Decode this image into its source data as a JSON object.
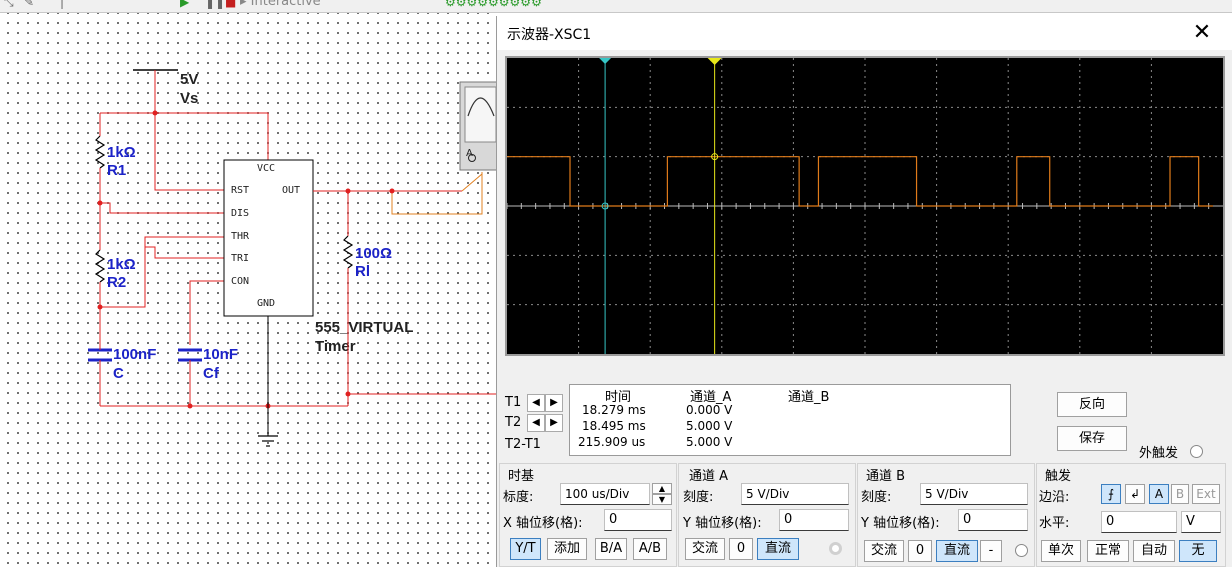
{
  "toolbar": {
    "sim_status": "▸ Interactive"
  },
  "schematic": {
    "vs_voltage": "5V",
    "vs_name": "Vs",
    "r1_value": "1kΩ",
    "r1_name": "R1",
    "r2_value": "1kΩ",
    "r2_name": "R2",
    "rl_value": "100Ω",
    "rl_name": "Rl",
    "c_value": "100nF",
    "c_name": "C",
    "cf_value": "10nF",
    "cf_name": "Cf",
    "timer_name": "555_VIRTUAL",
    "timer_type": "Timer",
    "pins": {
      "vcc": "VCC",
      "rst": "RST",
      "out": "OUT",
      "dis": "DIS",
      "thr": "THR",
      "tri": "TRI",
      "con": "CON",
      "gnd": "GND"
    },
    "probe_channel": "A"
  },
  "scope": {
    "title": "示波器-XSC1",
    "close_glyph": "✕",
    "cursor_t1": "T1",
    "cursor_t2": "T2",
    "cursor_diff": "T2-T1",
    "readout_headers": [
      "时间",
      "通道_A",
      "通道_B"
    ],
    "readout_rows": [
      {
        "time": "18.279 ms",
        "a": "0.000 V",
        "b": ""
      },
      {
        "time": "18.495 ms",
        "a": "5.000 V",
        "b": ""
      },
      {
        "time": "215.909 us",
        "a": "5.000 V",
        "b": ""
      }
    ],
    "reverse_button": "反向",
    "save_button": "保存",
    "ext_trigger_label": "外触发",
    "timebase": {
      "title": "时基",
      "scale_label": "标度:",
      "scale_value": "100 us/Div",
      "xpos_label": "X 轴位移(格):",
      "xpos_value": "0",
      "mode_buttons": [
        "Y/T",
        "添加",
        "B/A",
        "A/B"
      ],
      "selected_mode": "Y/T"
    },
    "channel_a": {
      "title": "通道 A",
      "scale_label": "刻度:",
      "scale_value": "5  V/Div",
      "ypos_label": "Y 轴位移(格):",
      "ypos_value": "0",
      "coupling_buttons": [
        "交流",
        "0",
        "直流"
      ],
      "selected_coupling": "直流"
    },
    "channel_b": {
      "title": "通道 B",
      "scale_label": "刻度:",
      "scale_value": "5  V/Div",
      "ypos_label": "Y 轴位移(格):",
      "ypos_value": "0",
      "coupling_buttons": [
        "交流",
        "0",
        "直流",
        "-"
      ],
      "selected_coupling": "直流"
    },
    "trigger": {
      "title": "触发",
      "edge_label": "边沿:",
      "source_buttons": [
        "A",
        "B",
        "Ext"
      ],
      "selected_source": "A",
      "level_label": "水平:",
      "level_value": "0",
      "level_unit": "V",
      "mode_buttons": [
        "单次",
        "正常",
        "自动",
        "无"
      ],
      "selected_mode": "无"
    },
    "colors": {
      "trace_a": "#e07b1a",
      "cursor1": "#36c6c6",
      "cursor2": "#e8e81a",
      "grid": "#8a8a8a",
      "screen_bg": "#000000",
      "wire": "#e02020",
      "label_blue": "#1c23c8"
    },
    "waveform_channel_a": {
      "high_level_div": 1,
      "low_level_div": 0,
      "transitions_div": [
        0,
        0.88,
        2.24,
        4.08,
        4.35,
        5.72,
        7.12,
        7.58,
        9.26,
        9.66
      ]
    },
    "cursor_positions_div": {
      "t1": 1.37,
      "t2": 2.9
    }
  }
}
